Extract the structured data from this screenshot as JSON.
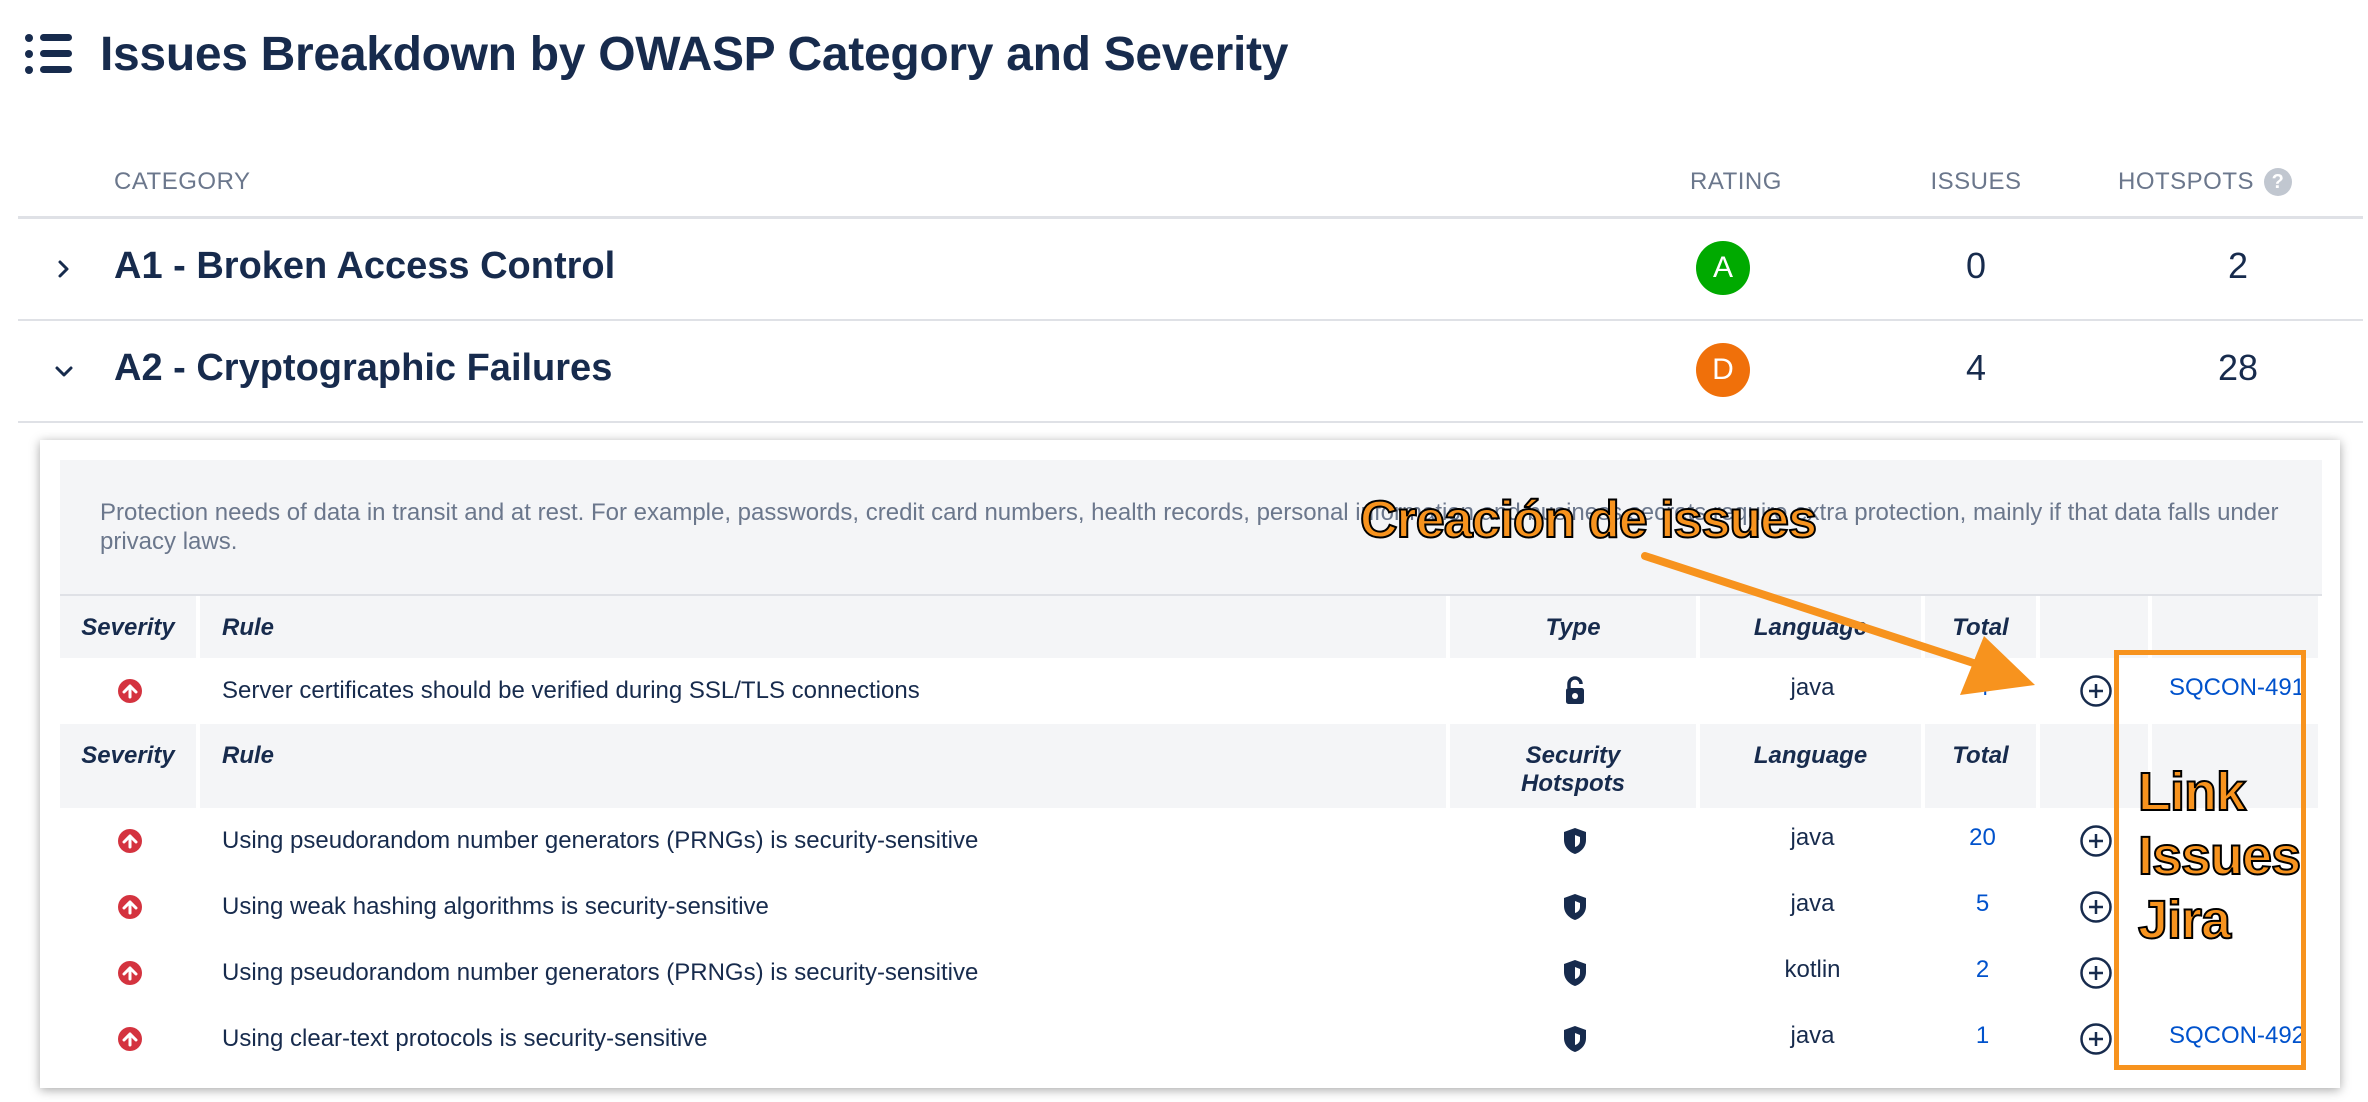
{
  "header": {
    "title": "Issues Breakdown by OWASP Category and Severity",
    "menu_icon": "list-icon"
  },
  "category_table": {
    "columns": {
      "category": "CATEGORY",
      "rating": "RATING",
      "issues": "ISSUES",
      "hotspots": "HOTSPOTS"
    },
    "help_glyph": "?",
    "rows": [
      {
        "name": "A1 - Broken Access Control",
        "rating": "A",
        "rating_color": "#00aa00",
        "issues": "0",
        "hotspots": "2",
        "expanded": false
      },
      {
        "name": "A2 - Cryptographic Failures",
        "rating": "D",
        "rating_color": "#f0700a",
        "issues": "4",
        "hotspots": "28",
        "expanded": true
      }
    ]
  },
  "detail": {
    "description": "Protection needs of data in transit and at rest. For example, passwords, credit card numbers, health records, personal information and business secrets require extra protection, mainly if that data falls under privacy laws.",
    "issues_header": {
      "severity": "Severity",
      "rule": "Rule",
      "type": "Type",
      "language": "Language",
      "total": "Total"
    },
    "issues": [
      {
        "rule": "Server certificates should be verified during SSL/TLS connections",
        "type_icon": "unlock-icon",
        "language": "java",
        "total": "4",
        "jira": "SQCON-491"
      }
    ],
    "hotspots_header": {
      "severity": "Severity",
      "rule": "Rule",
      "type_line1": "Security",
      "type_line2": "Hotspots",
      "language": "Language",
      "total": "Total"
    },
    "hotspots": [
      {
        "rule": "Using pseudorandom number generators (PRNGs) is security-sensitive",
        "language": "java",
        "total": "20",
        "jira": ""
      },
      {
        "rule": "Using weak hashing algorithms is security-sensitive",
        "language": "java",
        "total": "5",
        "jira": ""
      },
      {
        "rule": "Using pseudorandom number generators (PRNGs) is security-sensitive",
        "language": "kotlin",
        "total": "2",
        "jira": ""
      },
      {
        "rule": "Using clear-text protocols is security-sensitive",
        "language": "java",
        "total": "1",
        "jira": "SQCON-492"
      }
    ]
  },
  "annotations": {
    "issue_creation": "Creación de issues",
    "jira_link_line1": "Link",
    "jira_link_line2": "Issues",
    "jira_link_line3": "Jira",
    "accent_color": "#f7931e"
  }
}
